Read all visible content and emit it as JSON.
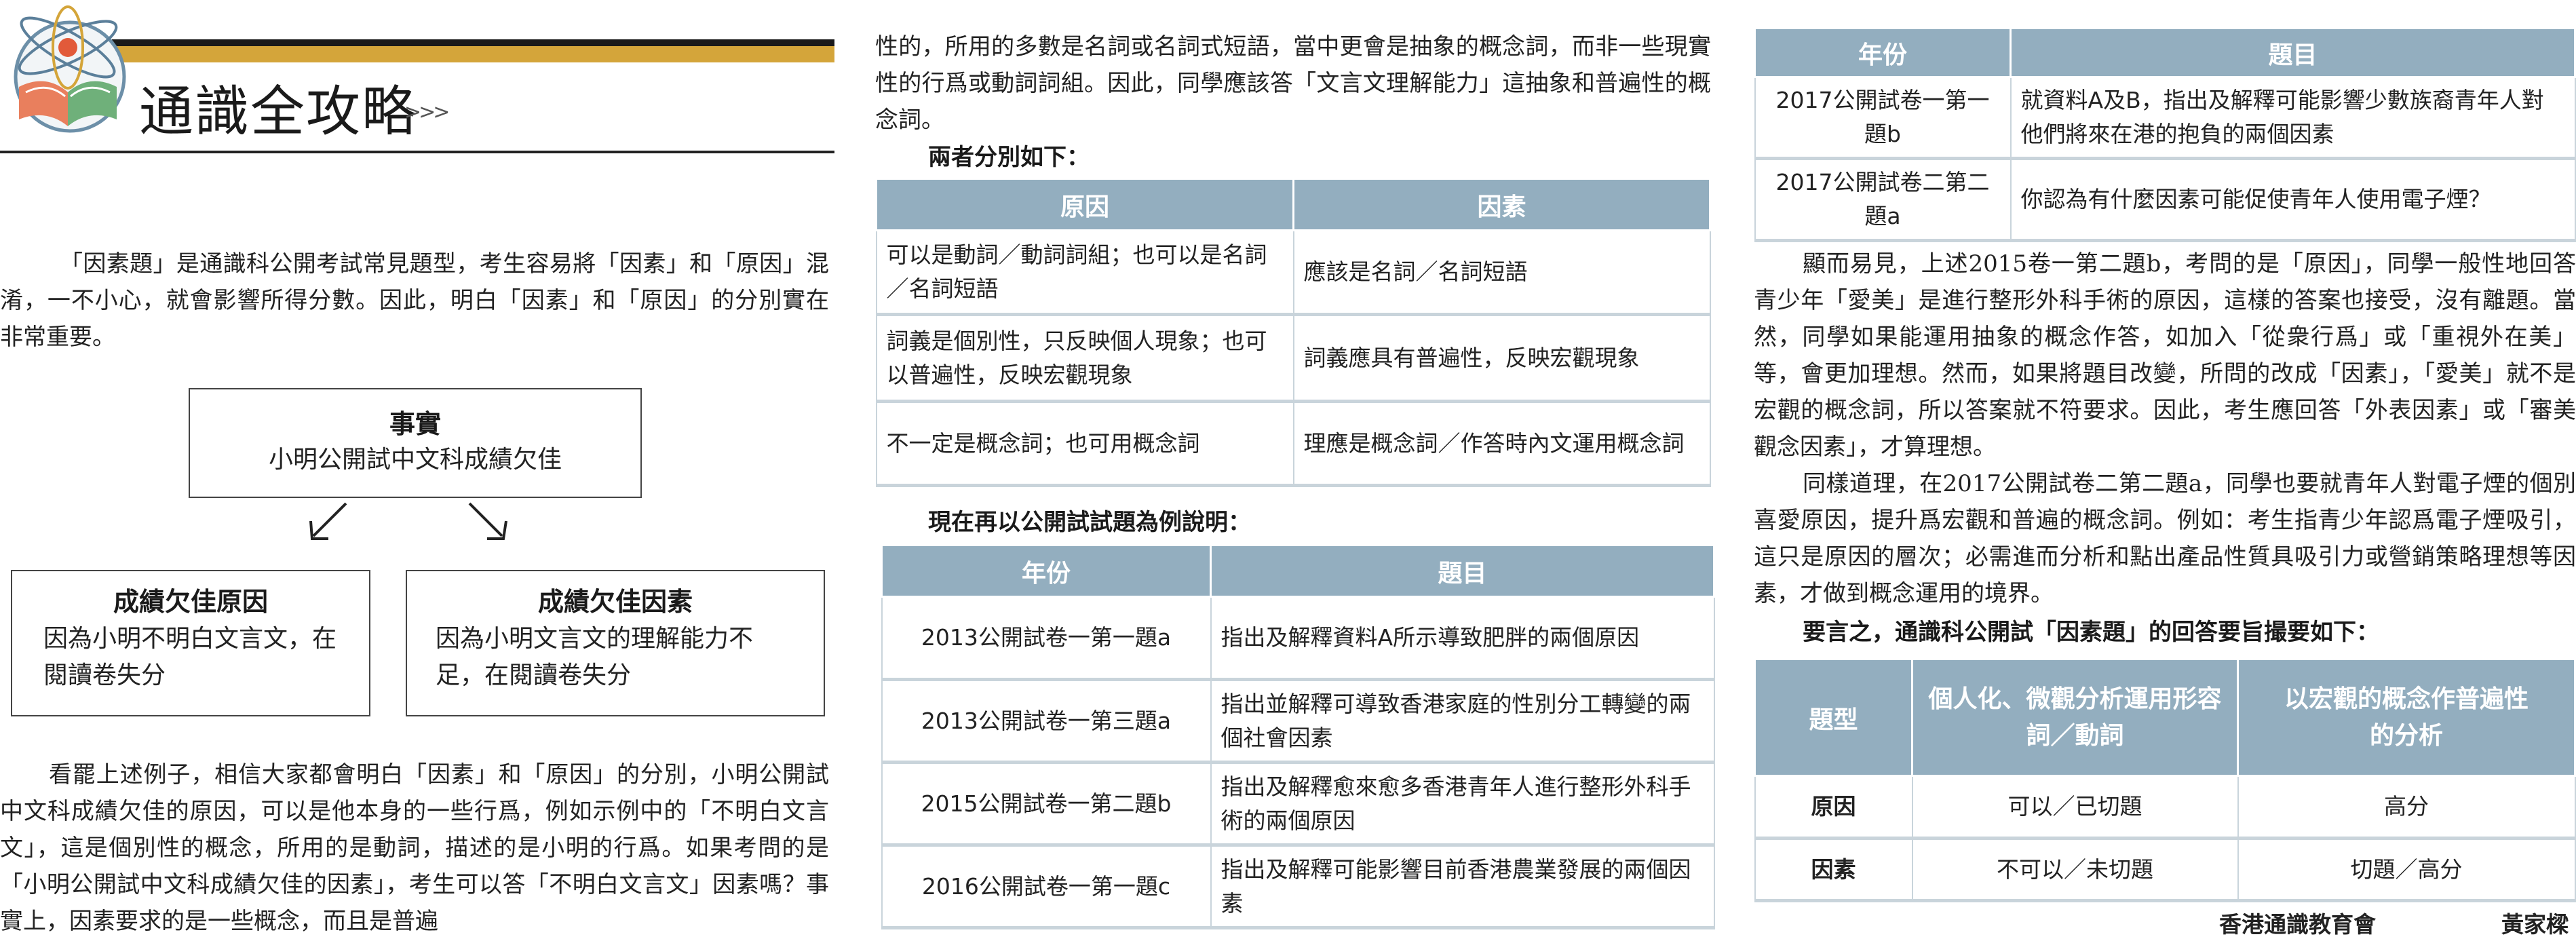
{
  "header": {
    "title": "通識全攻略",
    "arrows": ">>>"
  },
  "col1": {
    "p1": "「因素題」是通識科公開考試常見題型，考生容易將「因素」和「原因」混淆，一不小心，就會影響所得分數。因此，明白「因素」和「原因」的分別實在非常重要。",
    "diagram": {
      "fact_title": "事實",
      "fact_body": "小明公開試中文科成績欠佳",
      "reason_title": "成績欠佳原因",
      "reason_body": "因為小明不明白文言文，在閱讀卷失分",
      "factor_title": "成績欠佳因素",
      "factor_body": "因為小明文言文的理解能力不足，在閱讀卷失分"
    },
    "p2": "看罷上述例子，相信大家都會明白「因素」和「原因」的分別，小明公開試中文科成績欠佳的原因，可以是他本身的一些行爲，例如示例中的「不明白文言文」，這是個別性的概念，所用的是動詞，描述的是小明的行爲。如果考問的是「小明公開試中文科成績欠佳的因素」，考生可以答「不明白文言文」因素嗎？事實上，因素要求的是一些概念，而且是普遍"
  },
  "col2": {
    "p1": "性的，所用的多數是名詞或名詞式短語，當中更會是抽象的概念詞，而非一些現實性的行爲或動詞詞組。因此，同學應該答「文言文理解能力」這抽象和普遍性的概念詞。",
    "sub1": "兩者分別如下：",
    "t1": {
      "headers": [
        "原因",
        "因素"
      ],
      "rows": [
        [
          "可以是動詞／動詞詞組；也可以是名詞／名詞短語",
          "應該是名詞／名詞短語"
        ],
        [
          "詞義是個別性，只反映個人現象；也可以普遍性，反映宏觀現象",
          "詞義應具有普遍性，反映宏觀現象"
        ],
        [
          "不一定是概念詞；也可用概念詞",
          "理應是概念詞／作答時內文運用概念詞"
        ]
      ]
    },
    "sub2": "現在再以公開試試題為例說明：",
    "t2": {
      "headers": [
        "年份",
        "題目"
      ],
      "rows": [
        [
          "2013公開試卷一第一題a",
          "指出及解釋資料A所示導致肥胖的兩個原因"
        ],
        [
          "2013公開試卷一第三題a",
          "指出並解釋可導致香港家庭的性別分工轉變的兩個社會因素"
        ],
        [
          "2015公開試卷一第二題b",
          "指出及解釋愈來愈多香港青年人進行整形外科手術的兩個原因"
        ],
        [
          "2016公開試卷一第一題c",
          "指出及解釋可能影響目前香港農業發展的兩個因素"
        ]
      ]
    }
  },
  "col3": {
    "t3": {
      "headers": [
        "年份",
        "題目"
      ],
      "rows": [
        [
          "2017公開試卷一第一題b",
          "就資料A及B，指出及解釋可能影響少數族裔青年人對他們將來在港的抱負的兩個因素"
        ],
        [
          "2017公開試卷二第二題a",
          "你認為有什麼因素可能促使青年人使用電子煙？"
        ]
      ]
    },
    "p1": "顯而易見，上述2015卷一第二題b，考問的是「原因」，同學一般性地回答青少年「愛美」是進行整形外科手術的原因，這樣的答案也接受，沒有離題。當然，同學如果能運用抽象的概念作答，如加入「從衆行爲」或「重視外在美」等，會更加理想。然而，如果將題目改變，所問的改成「因素」，「愛美」就不是宏觀的概念詞，所以答案就不符要求。因此，考生應回答「外表因素」或「審美觀念因素」，才算理想。",
    "p2": "同樣道理，在2017公開試卷二第二題a，同學也要就青年人對電子煙的個別喜愛原因，提升爲宏觀和普遍的概念詞。例如：考生指青少年認爲電子煙吸引，這只是原因的層次；必需進而分析和點出產品性質具吸引力或營銷策略理想等因素，才做到概念運用的境界。",
    "sub": "要言之，通識科公開試「因素題」的回答要旨撮要如下：",
    "t4": {
      "headers": [
        "題型",
        "個人化、微觀分析運用形容詞／動詞",
        "以宏觀的概念作普遍性的分析"
      ],
      "rows": [
        [
          "原因",
          "可以／已切題",
          "高分"
        ],
        [
          "因素",
          "不可以／未切題",
          "切題／高分"
        ]
      ]
    },
    "byline_org": "香港通識教育會",
    "byline_name": "黃家樑"
  }
}
